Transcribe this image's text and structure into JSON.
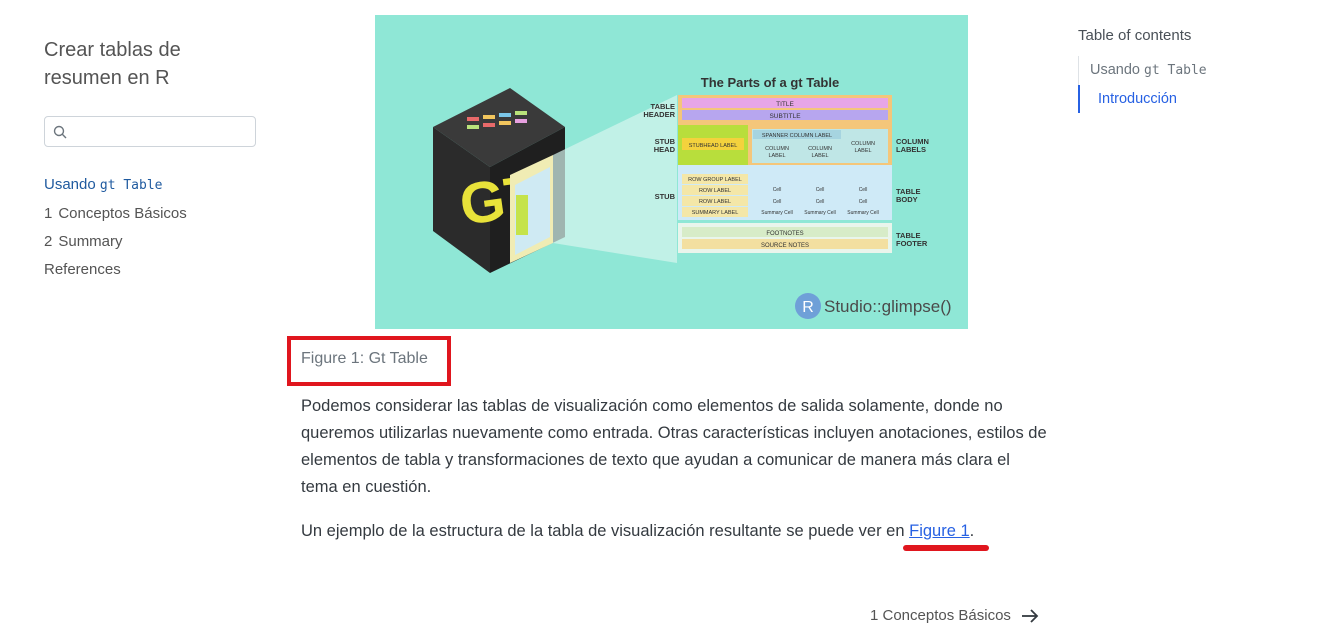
{
  "sidebar": {
    "title_line1": "Crear tablas de",
    "title_line2": "resumen en R",
    "search": {
      "value": "",
      "placeholder": ""
    },
    "nav": [
      {
        "label": "Usando ",
        "code": "gt Table"
      },
      {
        "number": "1",
        "label": "Conceptos Básicos"
      },
      {
        "number": "2",
        "label": "Summary"
      },
      {
        "label": "References"
      }
    ]
  },
  "figure": {
    "diagram_title": "The Parts of a gt Table",
    "left_labels": [
      "TABLE HEADER",
      "STUB HEAD",
      "STUB"
    ],
    "right_labels": [
      "COLUMN LABELS",
      "TABLE BODY",
      "TABLE FOOTER"
    ],
    "title": "TITLE",
    "subtitle": "SUBTITLE",
    "stubhead_label": "STUBHEAD LABEL",
    "spanner": "SPANNER COLUMN LABEL",
    "column_label": "COLUMN LABEL",
    "row_group_label": "ROW GROUP LABEL",
    "row_label": "ROW LABEL",
    "summary_label": "SUMMARY LABEL",
    "cell": "Cell",
    "summary_cell": "Summary Cell",
    "footnotes": "FOOTNOTES",
    "source_notes": "SOURCE NOTES",
    "brand": "Studio::glimpse()",
    "brand_r": "R",
    "caption": "Figure 1: Gt Table"
  },
  "content": {
    "paragraph1": "Podemos considerar las tablas de visualización como elementos de salida solamente, donde no queremos utilizarlas nuevamente como entrada. Otras características incluyen anotaciones, estilos de elementos de tabla y transformaciones de texto que ayudan a comunicar de manera más clara el tema en cuestión.",
    "paragraph2_prefix": "Un ejemplo de la estructura de la tabla de visualización resultante se puede ver en ",
    "paragraph2_link": "Figure 1",
    "paragraph2_suffix": ".",
    "next_page": "1  Conceptos Básicos"
  },
  "toc": {
    "title": "Table of contents",
    "items": [
      {
        "label": "Usando ",
        "code": "gt Table"
      },
      {
        "label": "Introducción"
      }
    ]
  },
  "colors": {
    "figure_bg": "#8fe7d6",
    "link": "#2761e3",
    "highlight": "#e0161e"
  }
}
